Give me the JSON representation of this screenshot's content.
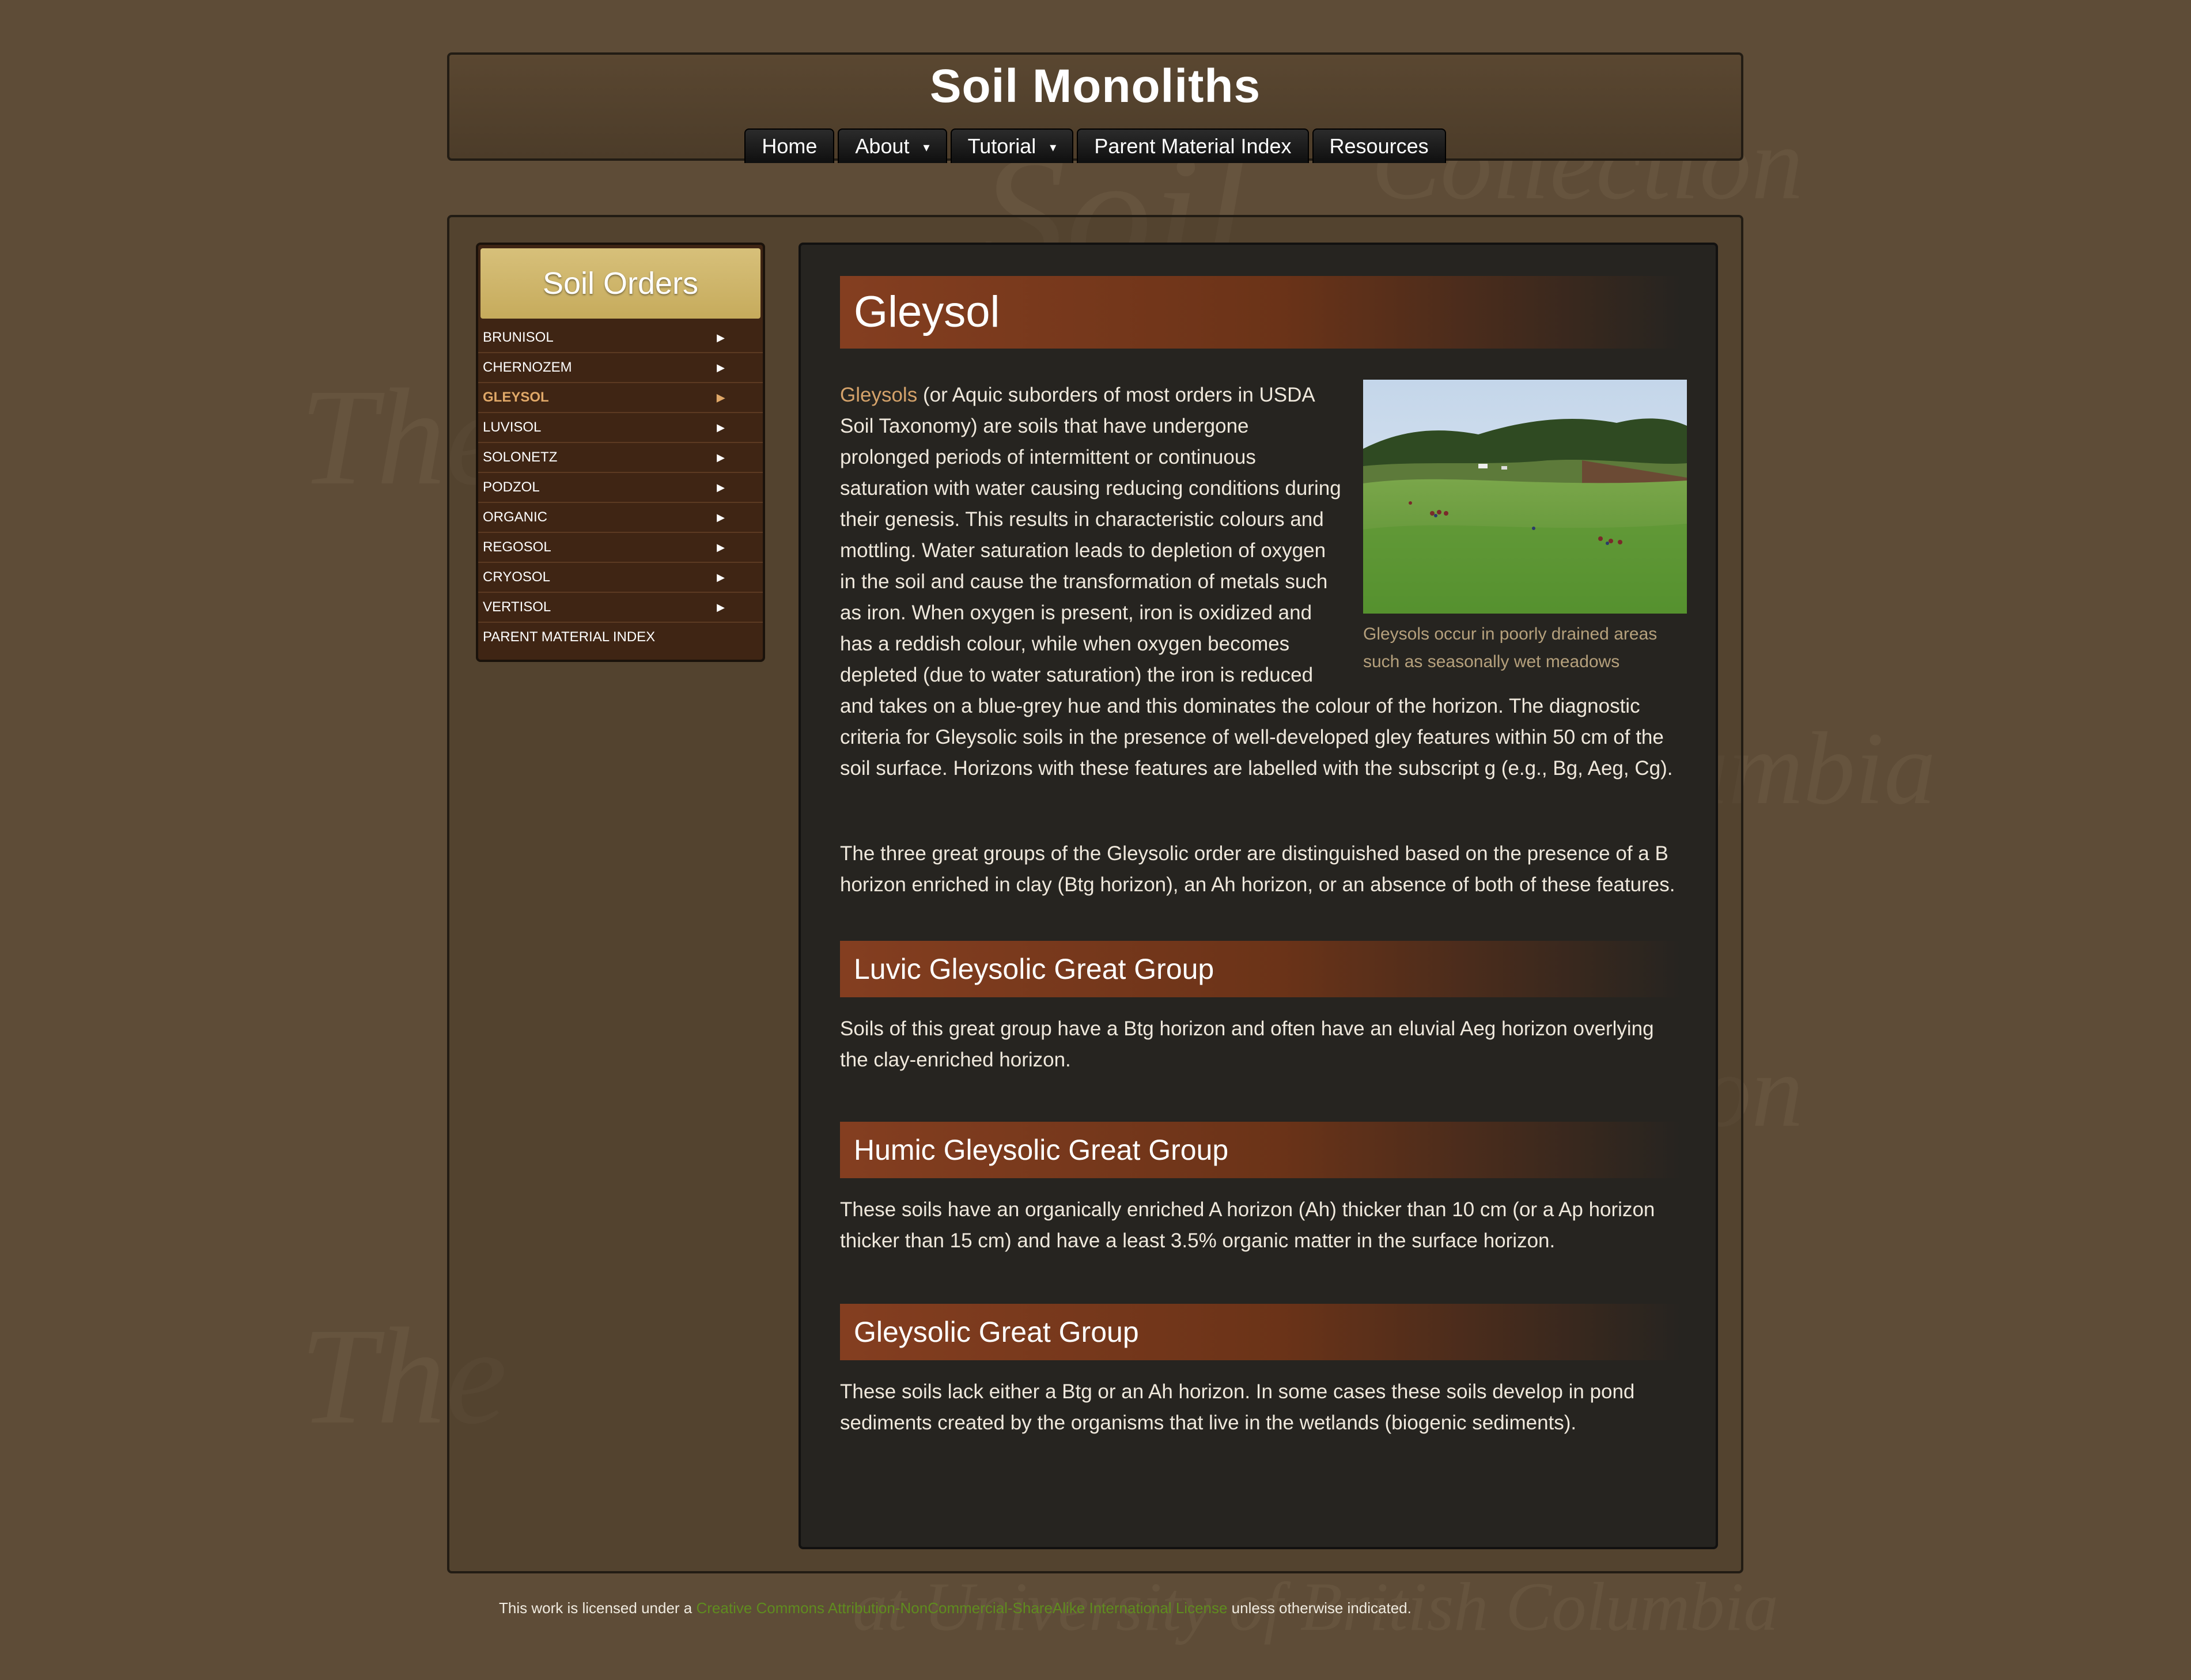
{
  "header": {
    "title": "Soil Monoliths",
    "nav": [
      {
        "label": "Home"
      },
      {
        "label": "About",
        "caret": "▾"
      },
      {
        "label": "Tutorial",
        "caret": "▾"
      },
      {
        "label": "Parent Material Index"
      },
      {
        "label": "Resources"
      }
    ]
  },
  "sidebar": {
    "title": "Soil Orders",
    "arrow": "▶",
    "items": [
      {
        "label": "BRUNISOL"
      },
      {
        "label": "CHERNOZEM"
      },
      {
        "label": "GLEYSOL",
        "active": true
      },
      {
        "label": "LUVISOL"
      },
      {
        "label": "SOLONETZ"
      },
      {
        "label": "PODZOL"
      },
      {
        "label": "ORGANIC"
      },
      {
        "label": "REGOSOL"
      },
      {
        "label": "CRYOSOL"
      },
      {
        "label": "VERTISOL"
      },
      {
        "label": "PARENT MATERIAL INDEX"
      }
    ]
  },
  "main": {
    "heading": "Gleysol",
    "intro_link": "Gleysols",
    "intro_text": " (or Aquic suborders of most orders in USDA Soil Taxonomy) are soils that have undergone prolonged periods of intermittent or continuous saturation with water causing reducing conditions during their genesis. This results in characteristic colours and mottling. Water saturation leads to depletion of oxygen in the soil and cause the transformation of metals such as iron. When oxygen is present, iron is oxidized and has a reddish colour, while when oxygen becomes depleted (due to water saturation) the iron is reduced and takes on a blue-grey hue and this dominates the colour of the horizon.  The diagnostic criteria for Gleysolic soils in the presence of well-developed gley features within 50 cm of the soil surface. Horizons with these features are labelled with the subscript g (e.g., Bg, Aeg, Cg).",
    "figure_caption": "Gleysols occur in poorly drained areas such as seasonally wet meadows",
    "para2": "The three great groups of the Gleysolic order are distinguished based on the presence of a B horizon enriched in clay (Btg horizon), an Ah horizon, or an absence of both of these features.",
    "sections": [
      {
        "title": "Luvic Gleysolic Great Group",
        "text": "Soils of this great group have a Btg horizon and often have an eluvial Aeg horizon overlying the clay-enriched horizon."
      },
      {
        "title": "Humic Gleysolic Great Group",
        "text": "These soils have an organically enriched A horizon (Ah) thicker than 10 cm (or a Ap horizon thicker than 15 cm) and have a least 3.5% organic matter in the surface horizon."
      },
      {
        "title": "Gleysolic Great Group",
        "text": "These soils lack either a Btg or an Ah horizon. In some cases these soils develop in pond sediments created by the organisms that live in the wetlands (biogenic sediments)."
      }
    ]
  },
  "footer": {
    "prefix": "This work is licensed under a ",
    "link": "Creative Commons Attribution-NonCommercial-ShareAlike International License",
    "suffix": " unless otherwise indicated."
  },
  "watermark": {
    "lines": [
      "The",
      "Collection",
      "Soil",
      "Columbia",
      "at University of British Columbia"
    ]
  },
  "colors": {
    "background": "#5e4c37",
    "banner": "#843e20",
    "sidebar_title": "#d4bc74",
    "active_item": "#e0a868",
    "footer_link": "#5f8c1f"
  }
}
